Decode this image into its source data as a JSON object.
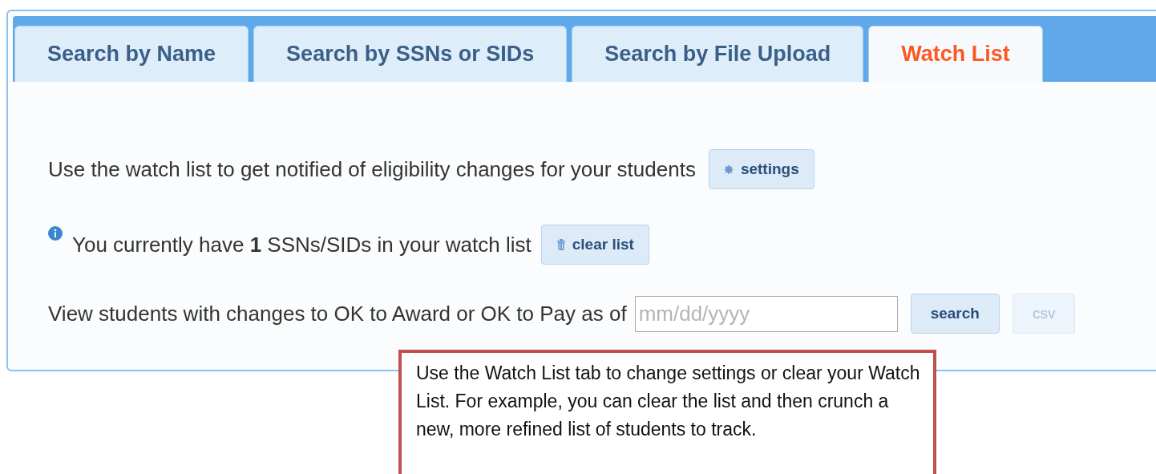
{
  "tabs": [
    {
      "label": "Search by Name",
      "selected": false
    },
    {
      "label": "Search by SSNs or SIDs",
      "selected": false
    },
    {
      "label": "Search by File Upload",
      "selected": false
    },
    {
      "label": "Watch List",
      "selected": true
    }
  ],
  "intro": {
    "text": "Use the watch list to get notified of eligibility changes for your students",
    "button": "settings"
  },
  "count": {
    "text": "You currently have **1** SSNs/SIDs in your watch list",
    "button": "clear list"
  },
  "view": {
    "text": "View students with changes to OK to Award or OK to Pay as of",
    "date_field": {
      "placeholder": "mm/dd/yyyy"
    },
    "search_button": "search",
    "csv_button": {
      "label": "csv",
      "disabled": true
    }
  },
  "callout": {
    "text": "Use the Watch List tab to change settings or clear your Watch List.  For example, you can clear the list and then crunch a new, more refined list of students to track."
  }
}
